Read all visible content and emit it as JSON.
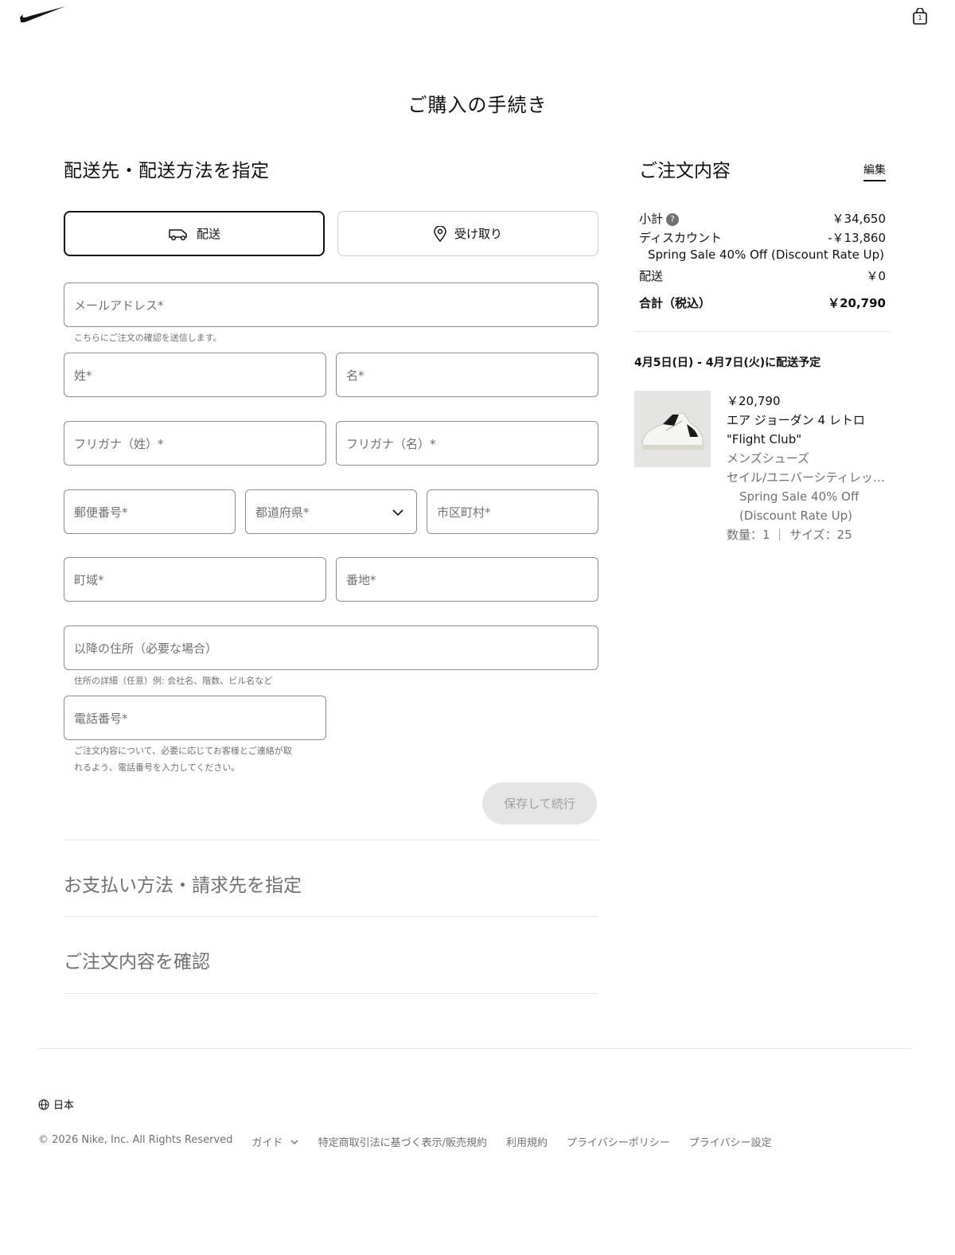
{
  "header": {
    "logo": "swoosh-logo",
    "bag_icon": "shopping-bag-icon",
    "bag_count": "1"
  },
  "page_title": "ご購入の手続き",
  "shipping": {
    "title": "配送先・配送方法を指定",
    "tab_delivery": "配送",
    "tab_pickup": "受け取り",
    "email_placeholder": "メールアドレス*",
    "email_hint": "こちらにご注文の確認を送信します。",
    "last_name": "姓*",
    "first_name": "名*",
    "last_kana": "フリガナ（姓）*",
    "first_kana": "フリガナ（名）*",
    "postal": "郵便番号*",
    "prefecture": "都道府県*",
    "city": "市区町村*",
    "town": "町域*",
    "street": "番地*",
    "address2": "以降の住所（必要な場合）",
    "address2_hint": "住所の詳細（任意）例: 会社名、階数、ビル名など",
    "phone": "電話番号*",
    "phone_hint_1": "ご注文内容について、必要に応じてお客様とご連絡が取",
    "phone_hint_2": "れるよう、電話番号を入力してください。",
    "save_button": "保存して続行"
  },
  "payment": {
    "title": "お支払い方法・請求先を指定"
  },
  "review": {
    "title": "ご注文内容を確認"
  },
  "summary": {
    "title": "ご注文内容",
    "edit": "編集",
    "subtotal_label": "小計",
    "subtotal_value": "￥34,650",
    "discount_label": "ディスカウント",
    "discount_value": "-￥13,860",
    "sale_note": "Spring Sale 40% Off (Discount Rate Up)",
    "shipping_label": "配送",
    "shipping_value": "￥0",
    "total_label": "合計（税込）",
    "total_value": "￥20,790",
    "delivery_estimate": "4月5日(日) - 4月7日(火)に配送予定"
  },
  "product": {
    "price": "￥20,790",
    "name_1": "エア ジョーダン 4 レトロ",
    "name_2": "\"Flight Club\"",
    "category": "メンズシューズ",
    "color": "セイル/ユニバーシティレッ…",
    "promo_1": "Spring Sale 40% Off",
    "promo_2": "(Discount Rate Up)",
    "qty_size": "数量：1 ｜ サイズ：25"
  },
  "footer": {
    "region": "日本",
    "copyright": "© 2026 Nike, Inc. All Rights Reserved",
    "guide": "ガイド",
    "link_1": "特定商取引法に基づく表示/販売規約",
    "link_2": "利用規約",
    "link_3": "プライバシーポリシー",
    "link_4": "プライバシー設定"
  }
}
